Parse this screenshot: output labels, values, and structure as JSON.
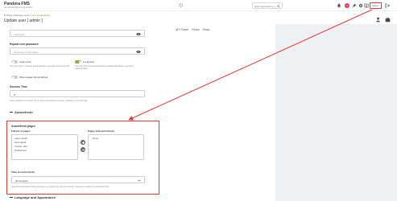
{
  "app": {
    "title": "Pandora FMS",
    "subtitle": "the Flexible Monitoring System"
  },
  "header": {
    "search_placeholder": "Enter keywords to s",
    "notification_count": "1",
    "user_label": "admin"
  },
  "breadcrumb": {
    "root": "Profiles / Manage users / ",
    "current": "User Detail Editor"
  },
  "page": {
    "title": "Update user [ admin ]"
  },
  "tabs": [
    "API Token",
    "Roles",
    "Show"
  ],
  "form": {
    "password_placeholder": "Password",
    "repeat_label": "Repeat new password",
    "repeat_placeholder": "Password confirmation",
    "login_error": {
      "label": "Login error",
      "enabled": false,
      "help": "The user with no access authentication succeeds access the API"
    },
    "local_user": {
      "label": "Local User",
      "enabled": true,
      "help": "The user with local authentication enabled will always use local authentication."
    },
    "usage_tips": {
      "label": "Show usage tips at startup",
      "enabled": false
    },
    "session_time_label": "Session Time",
    "session_time_value": "0",
    "session_time_help": "This is defined in minutes. If you want a permanent session, introduce -1 in this field.",
    "autorefresh_section": "Autorefresh",
    "language_section": "Language and Appearance"
  },
  "autorefresh": {
    "title": "Autorefresh pages",
    "full_list_label": "Full list of pages",
    "full_list": [
      "Agent detail",
      "Alert detail",
      "Cluster view",
      "Dashboard"
    ],
    "selected_label": "Pages with autorefresh",
    "selected": [
      "None"
    ],
    "time_label": "Time for autorefresh",
    "time_value": "30 seconds",
    "help": "Interval of autorefresh of the elements, by default they are 30 seconds, needing to enable the autorefresh first."
  },
  "colors": {
    "accent": "#82b92e",
    "annotation": "#e53935",
    "badge": "#e63c52"
  }
}
